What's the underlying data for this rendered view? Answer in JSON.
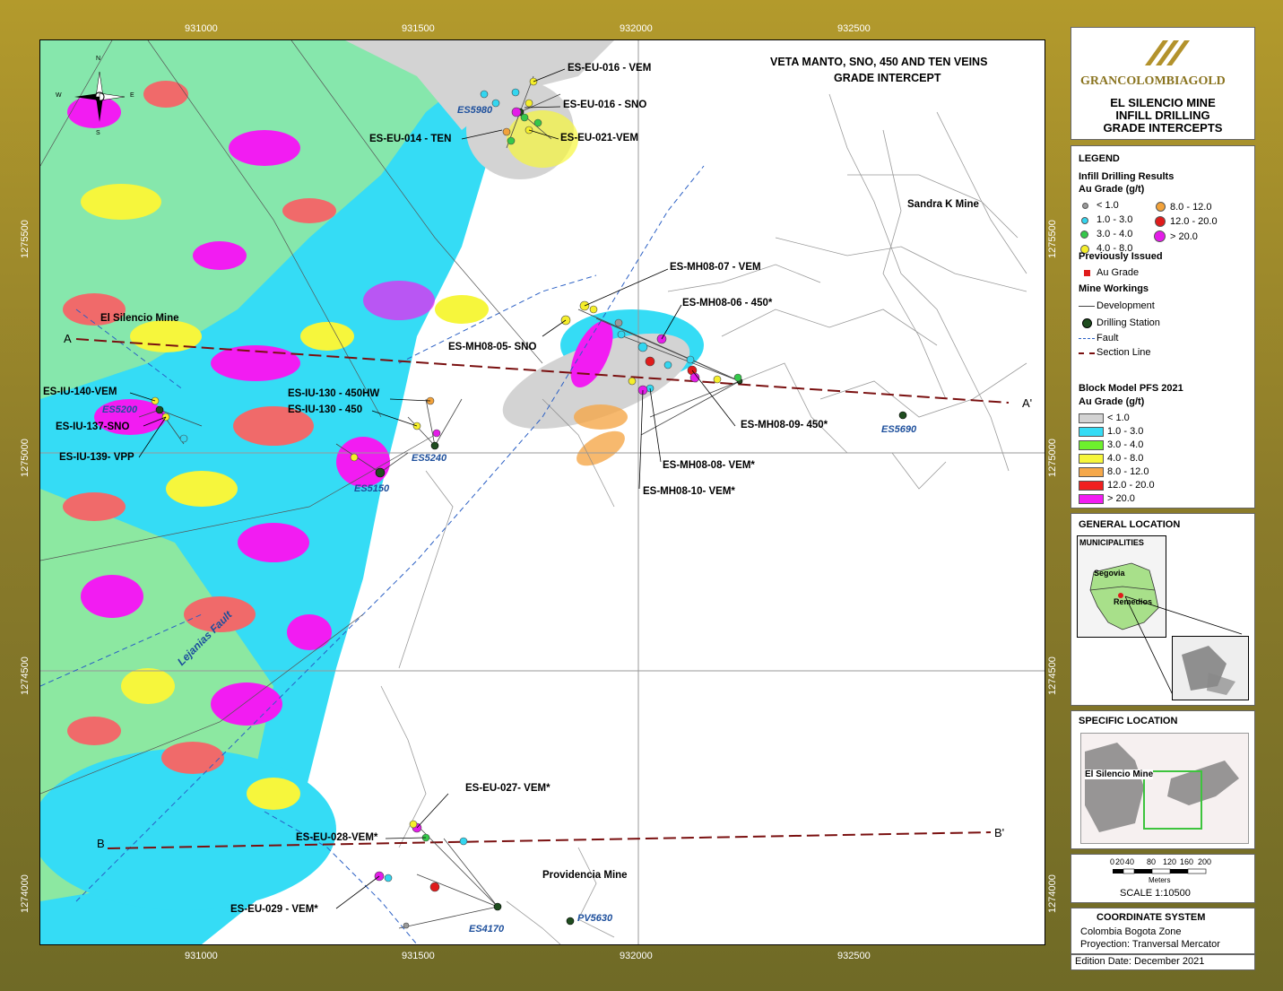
{
  "map": {
    "title_line1": "VETA MANTO, SNO, 450 AND TEN VEINS",
    "title_line2": "GRADE INTERCEPT",
    "x_ticks": [
      "931000",
      "931500",
      "932000",
      "932500"
    ],
    "y_ticks": [
      "1275500",
      "1275000",
      "1274500",
      "1274000"
    ],
    "fault_label": "Lejanias Fault",
    "section_a": "A",
    "section_a2": "A'",
    "section_b": "B",
    "section_b2": "B'",
    "mines": {
      "silencio": "El Silencio Mine",
      "sandra": "Sandra K Mine",
      "providencia": "Providencia Mine"
    },
    "stations": [
      "ES5980",
      "ES5200",
      "ES5240",
      "ES5150",
      "ES5690",
      "ES4170",
      "PV5630"
    ],
    "intercepts": [
      "ES-EU-016 - VEM",
      "ES-EU-016 - SNO",
      "ES-EU-014 - TEN",
      "ES-EU-021-VEM",
      "ES-MH08-07 - VEM",
      "ES-MH08-06 - 450*",
      "ES-MH08-05- SNO",
      "ES-MH08-09- 450*",
      "ES-MH08-08- VEM*",
      "ES-MH08-10- VEM*",
      "ES-IU-140-VEM",
      "ES-IU-137-SNO",
      "ES-IU-139- VPP",
      "ES-IU-130 - 450HW",
      "ES-IU-130 - 450",
      "ES-EU-027- VEM*",
      "ES-EU-028-VEM*",
      "ES-EU-029 - VEM*"
    ],
    "compass": {
      "n": "N",
      "s": "S",
      "e": "E",
      "w": "W"
    }
  },
  "title_block": {
    "logo_text": "GRANCOLOMBIAGOLD",
    "line1": "EL SILENCIO MINE",
    "line2": "INFILL DRILLING",
    "line3": "GRADE INTERCEPTS"
  },
  "legend": {
    "title": "LEGEND",
    "infill_title": "Infill Drilling Results",
    "infill_sub": "Au Grade (g/t)",
    "infill_classes": [
      {
        "label": "< 1.0",
        "color": "#9a9a9a"
      },
      {
        "label": "1.0 - 3.0",
        "color": "#33d6f0"
      },
      {
        "label": "3.0 - 4.0",
        "color": "#35c84a"
      },
      {
        "label": "4.0 - 8.0",
        "color": "#f5ee2a"
      },
      {
        "label": "8.0 - 12.0",
        "color": "#f2a23a"
      },
      {
        "label": "12.0 - 20.0",
        "color": "#e01b1b"
      },
      {
        "label": "> 20.0",
        "color": "#e41ce8"
      }
    ],
    "prev_title": "Previously Issued",
    "prev_item": "Au Grade",
    "workings_title": "Mine Workings",
    "development": "Development",
    "drilling_station": "Drilling Station",
    "fault": "Fault",
    "section_line": "Section Line",
    "block_title": "Block Model PFS 2021",
    "block_sub": "Au Grade (g/t)",
    "block_classes": [
      {
        "label": "< 1.0",
        "color": "#d3d3d3"
      },
      {
        "label": "1.0 - 3.0",
        "color": "#35dcf5"
      },
      {
        "label": "3.0 - 4.0",
        "color": "#6df02c"
      },
      {
        "label": "4.0 - 8.0",
        "color": "#f6f63c"
      },
      {
        "label": "8.0 - 12.0",
        "color": "#f5a84a"
      },
      {
        "label": "12.0 - 20.0",
        "color": "#f02020"
      },
      {
        "label": "> 20.0",
        "color": "#f21cf2"
      }
    ]
  },
  "general_location": {
    "title": "GENERAL LOCATION",
    "municipalities": "MUNICIPALITIES",
    "segovia": "Segovia",
    "remedios": "Remedios"
  },
  "specific_location": {
    "title": "SPECIFIC LOCATION",
    "label": "El Silencio Mine"
  },
  "scale": {
    "ticks": [
      "0",
      "20",
      "40",
      "80",
      "120",
      "160",
      "200"
    ],
    "unit": "Meters",
    "text": "SCALE  1:10500"
  },
  "coordinate_system": {
    "title": "COORDINATE SYSTEM",
    "line1": "Colombia Bogota Zone",
    "line2": "Proyection: Tranversal Mercator"
  },
  "edition": "Edition Date: December 2021"
}
